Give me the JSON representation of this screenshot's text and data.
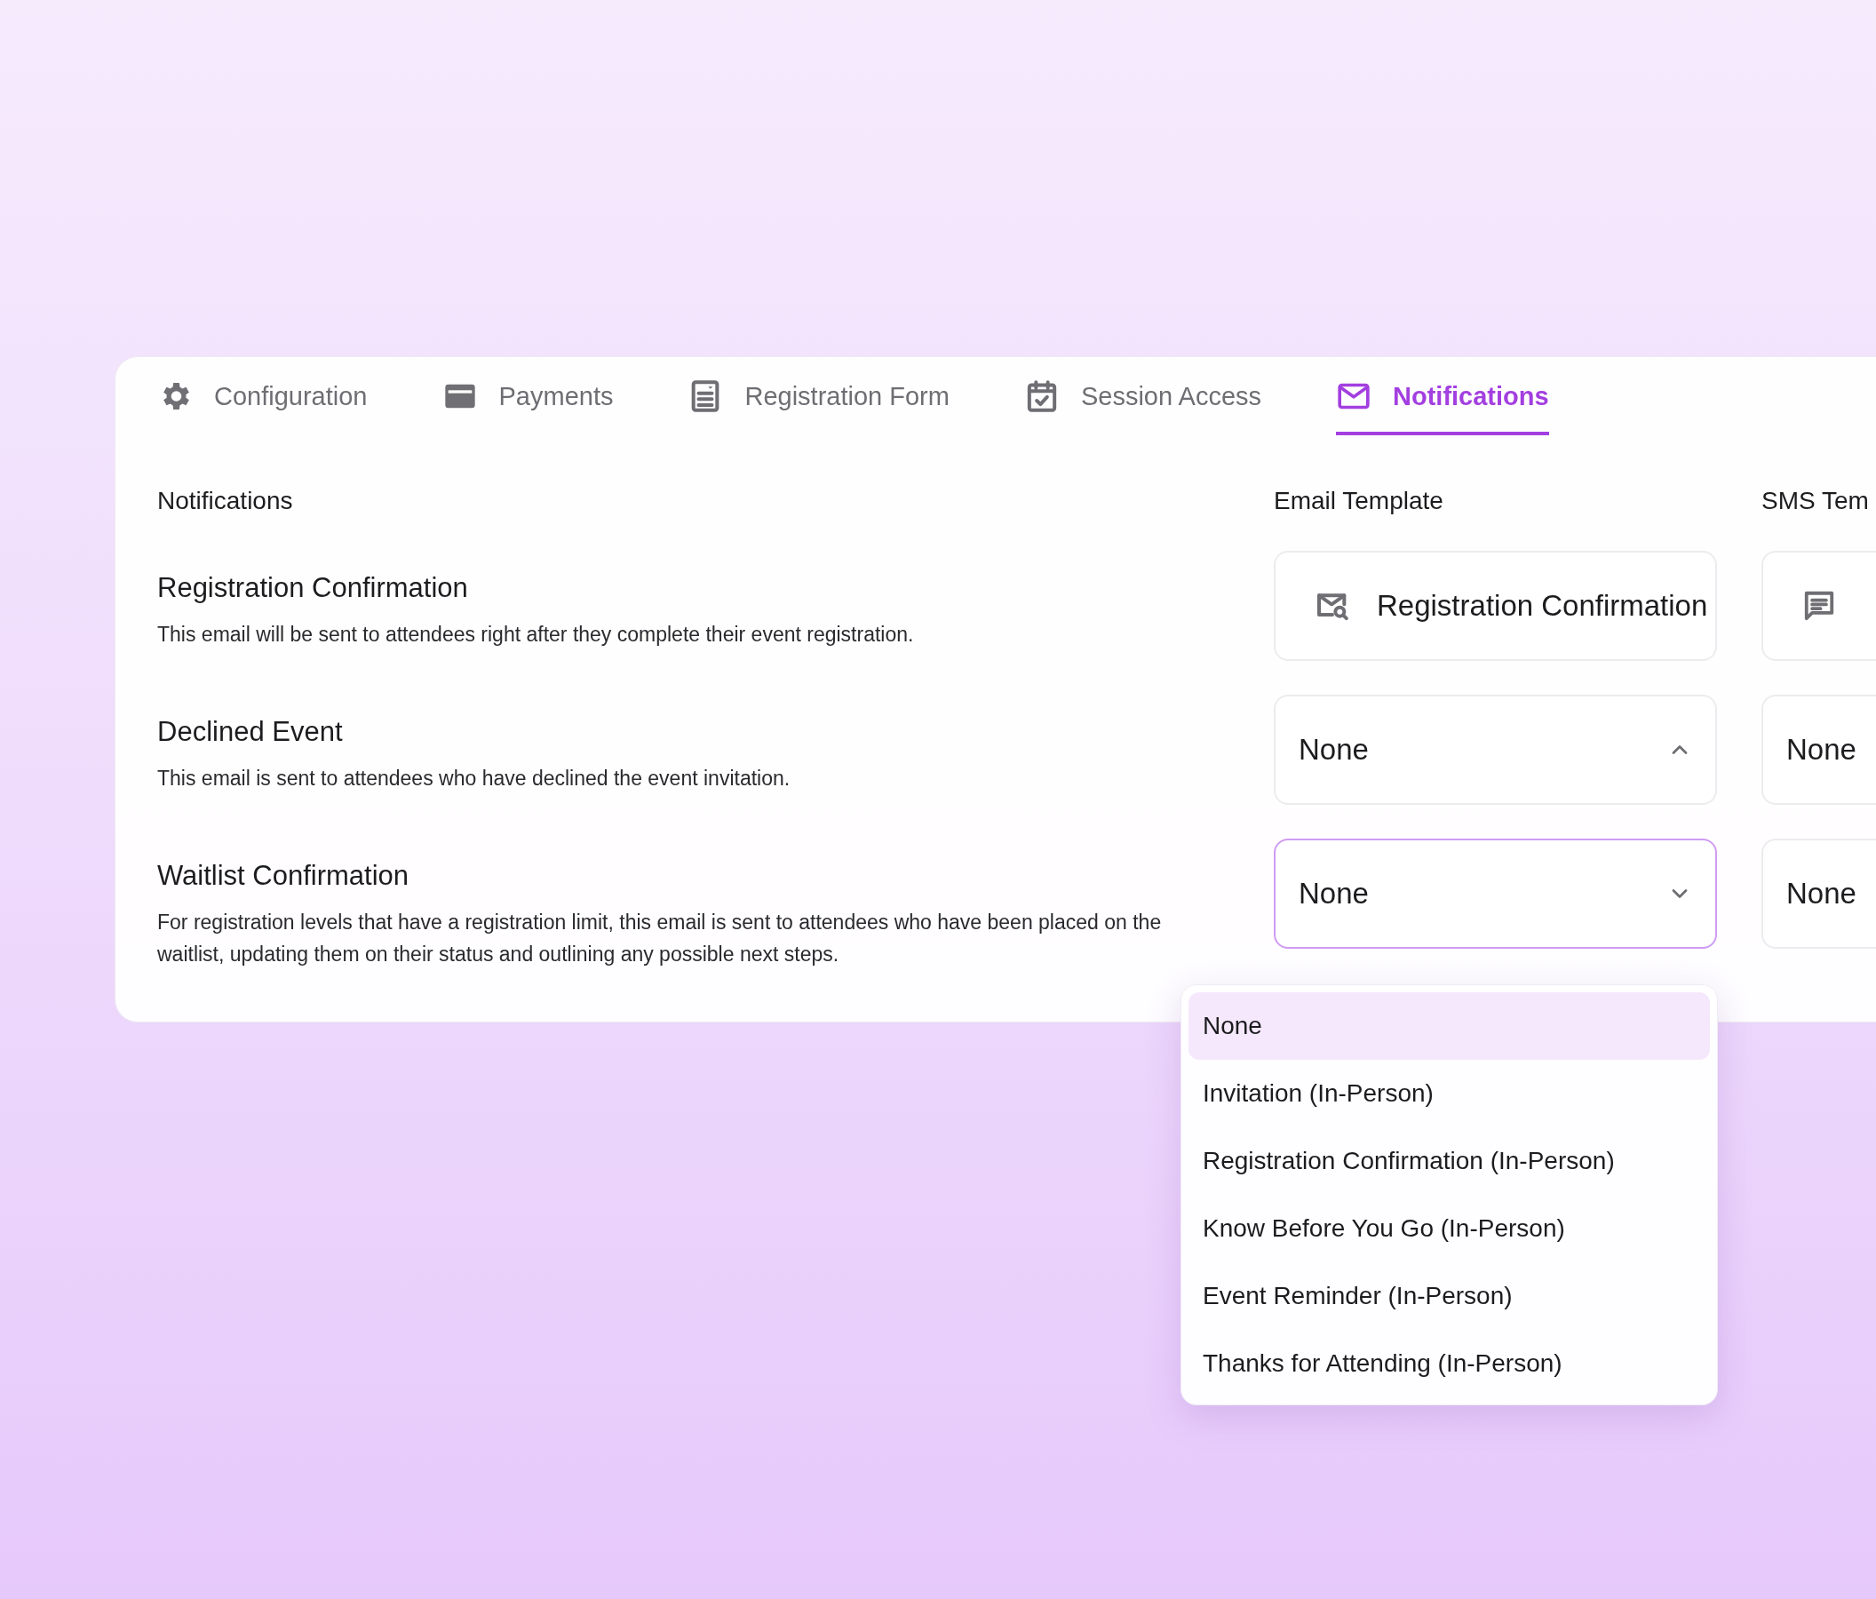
{
  "tabs": [
    {
      "label": "Configuration",
      "selected": false
    },
    {
      "label": "Payments",
      "selected": false
    },
    {
      "label": "Registration Form",
      "selected": false
    },
    {
      "label": "Session Access",
      "selected": false
    },
    {
      "label": "Notifications",
      "selected": true
    }
  ],
  "columns": {
    "notifications": "Notifications",
    "email_template": "Email Template",
    "sms_template": "SMS Tem"
  },
  "rows": [
    {
      "title": "Registration Confirmation",
      "description": "This email will be sent to attendees right after they complete their event registration.",
      "email": {
        "kind": "template",
        "value": "Registration Confirmation"
      },
      "sms": {
        "kind": "template"
      }
    },
    {
      "title": "Declined Event",
      "description": "This email is sent to attendees who have declined the event invitation.",
      "email": {
        "kind": "select",
        "value": "None",
        "expanded": true,
        "focused": false
      },
      "sms": {
        "kind": "select",
        "value": "None"
      }
    },
    {
      "title": "Waitlist Confirmation",
      "description": "For registration levels that have a registration limit, this email is sent to attendees who have been placed on the waitlist, updating them on their status and outlining any possible next steps.",
      "email": {
        "kind": "select",
        "value": "None",
        "expanded": false,
        "focused": true
      },
      "sms": {
        "kind": "select",
        "value": "None"
      }
    }
  ],
  "dropdown": {
    "items": [
      {
        "label": "None",
        "selected": true
      },
      {
        "label": "Invitation (In-Person)",
        "selected": false
      },
      {
        "label": "Registration Confirmation (In-Person)",
        "selected": false
      },
      {
        "label": "Know Before You Go (In-Person)",
        "selected": false
      },
      {
        "label": "Event Reminder (In-Person)",
        "selected": false
      },
      {
        "label": "Thanks for Attending (In-Person)",
        "selected": false
      }
    ]
  }
}
